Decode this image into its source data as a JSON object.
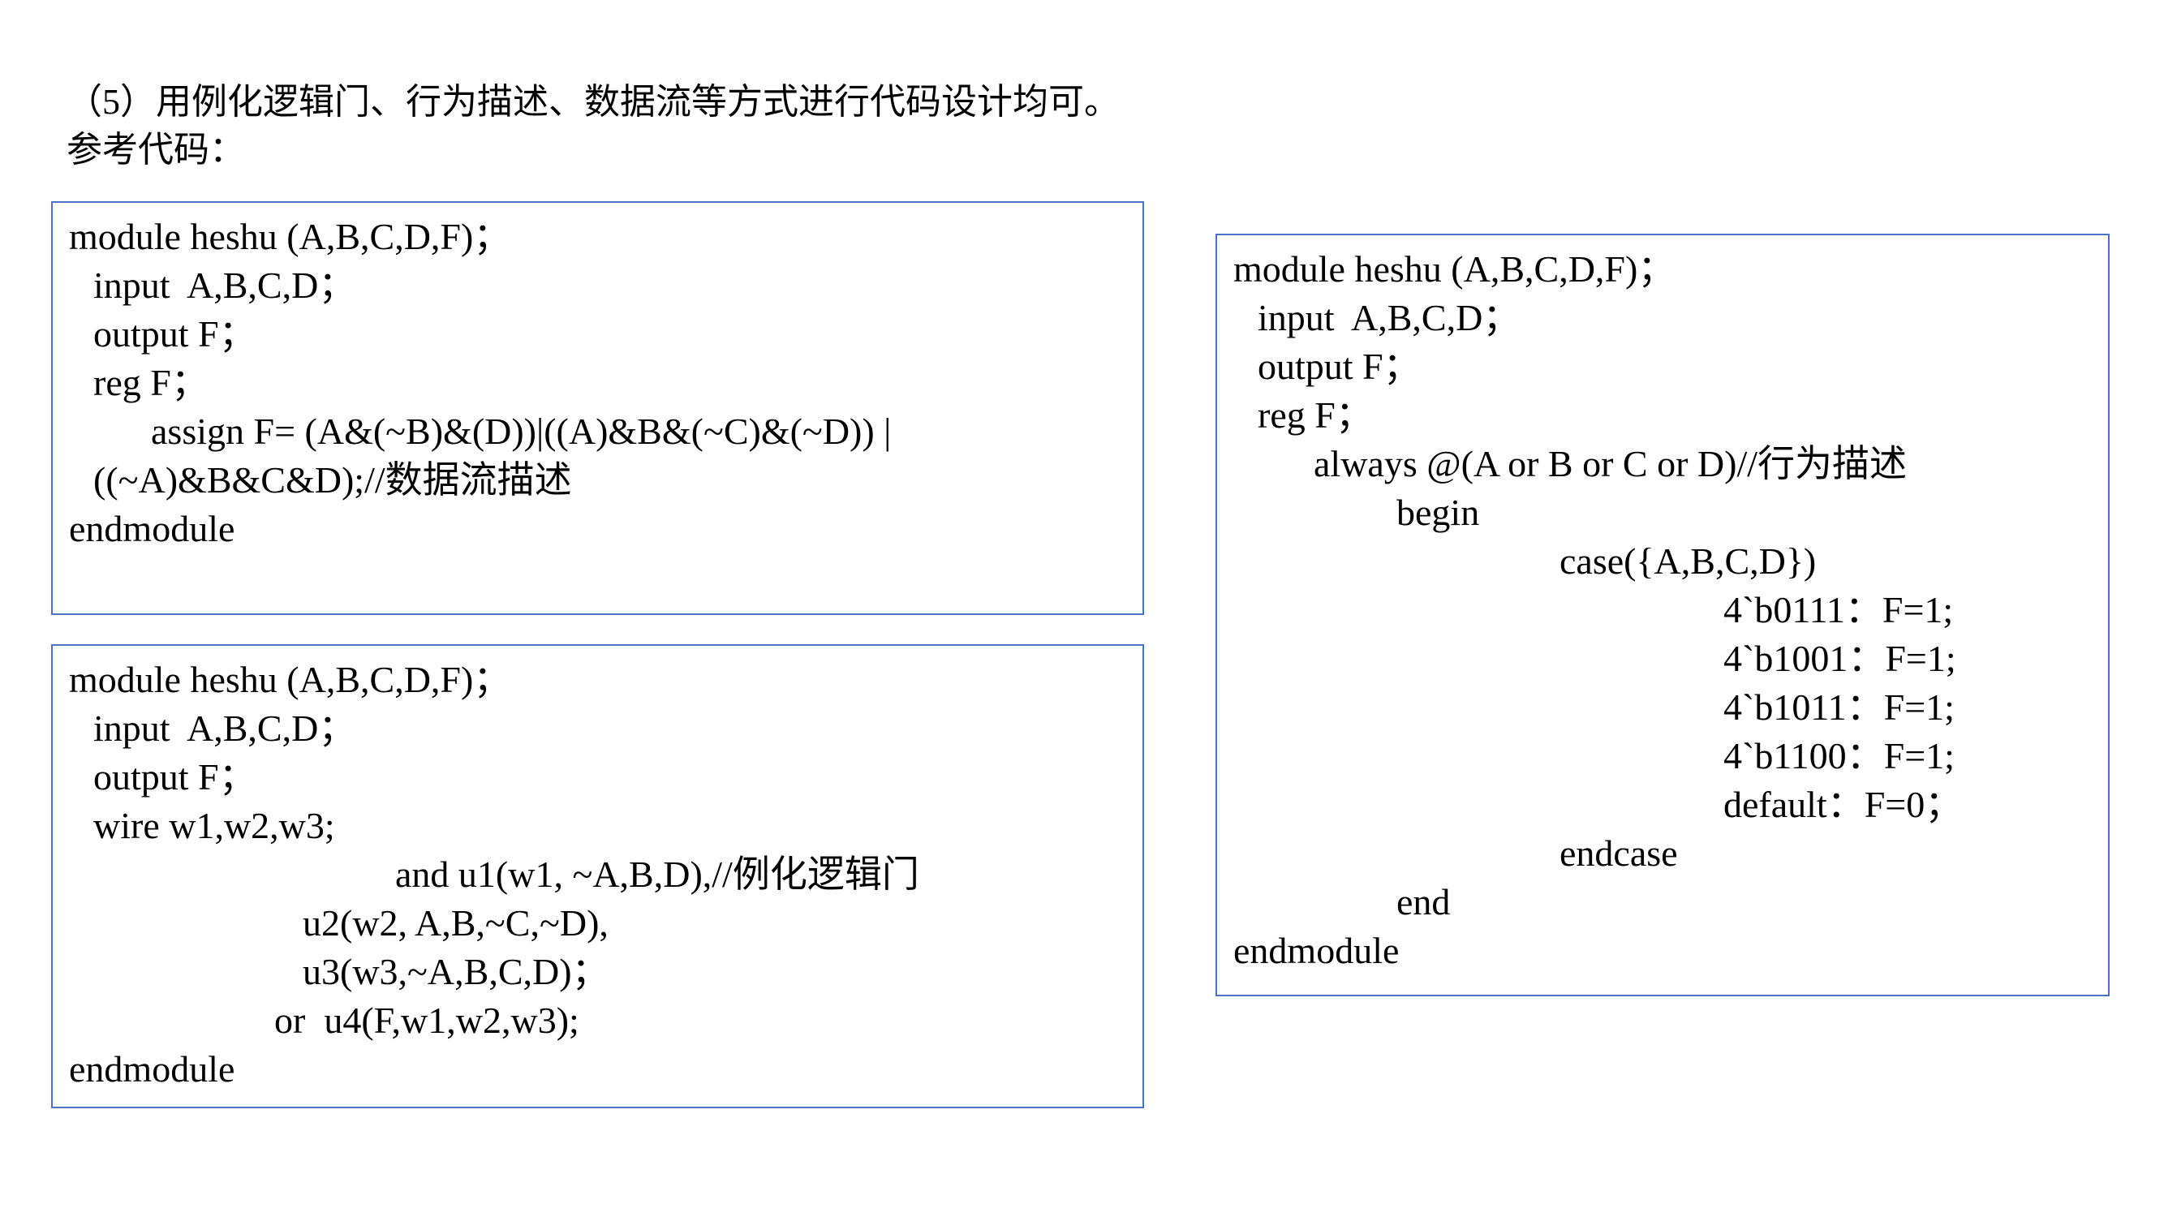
{
  "heading": {
    "line1": "（5）用例化逻辑门、行为描述、数据流等方式进行代码设计均可。",
    "line2": "参考代码："
  },
  "dataflow_code": {
    "lines": [
      "module heshu (A,B,C,D,F)；",
      "input  A,B,C,D；",
      "output F；",
      "reg F；",
      "assign F= (A&(~B)&(D))|((A)&B&(~C)&(~D)) |",
      "((~A)&B&C&D);//数据流描述",
      "endmodule"
    ]
  },
  "gate_code": {
    "lines": [
      "module heshu (A,B,C,D,F)；",
      "input  A,B,C,D；",
      "output F；",
      "wire w1,w2,w3;",
      "and u1(w1, ~A,B,D),//例化逻辑门",
      "u2(w2, A,B,~C,~D),",
      "u3(w3,~A,B,C,D)；",
      "or  u4(F,w1,w2,w3);",
      "endmodule"
    ]
  },
  "behavior_code": {
    "lines": [
      "module heshu (A,B,C,D,F)；",
      "input  A,B,C,D；",
      "output F；",
      "reg F；",
      "always @(A or B or C or D)//行为描述",
      "begin",
      "case({A,B,C,D})",
      "4`b0111：F=1;",
      "4`b1001：F=1;",
      "4`b1011：F=1;",
      "4`b1100：F=1;",
      "default：F=0；",
      "endcase",
      "end",
      "endmodule"
    ]
  },
  "colors": {
    "box_border": "#4a72c8",
    "text": "#000000",
    "background": "#ffffff"
  }
}
